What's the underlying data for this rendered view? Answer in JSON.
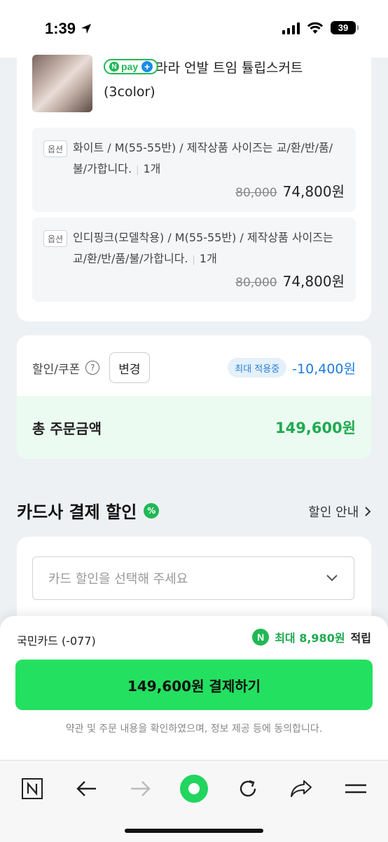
{
  "status_bar": {
    "time": "1:39",
    "battery": "39"
  },
  "product": {
    "npay_label": "pay",
    "npay_n": "N",
    "title": "라라 언발 트임 튤립스커트 (3color)",
    "options": [
      {
        "tag": "옵션",
        "description": "화이트 / M(55-55반) / 제작상품 사이즈는 교/환/반/품/불/가합니다.",
        "qty": "1개",
        "original_price": "80,000",
        "sale_price": "74,800원"
      },
      {
        "tag": "옵션",
        "description": "인디핑크(모델착용) / M(55-55반) / 제작상품 사이즈는 교/환/반/품/불/가합니다.",
        "qty": "1개",
        "original_price": "80,000",
        "sale_price": "74,800원"
      }
    ]
  },
  "summary": {
    "discount_label": "할인/쿠폰",
    "help": "?",
    "change_button": "변경",
    "max_badge": "최대 적용중",
    "discount_amount": "-10,400원",
    "total_label": "총 주문금액",
    "total_amount": "149,600원"
  },
  "card_discount": {
    "title": "카드사 결제 할인",
    "badge": "%",
    "guide_link": "할인 안내",
    "select_placeholder": "카드 할인을 선택해 주세요"
  },
  "checkout": {
    "card_name": "국민카드 (-077)",
    "reward_icon": "N",
    "reward_amount": "최대 8,980원",
    "reward_suffix": "적립",
    "pay_button": "149,600원 결제하기",
    "agreement": "약관 및 주문 내용을 확인하였으며, 정보 제공 등에 동의합니다."
  },
  "colors": {
    "accent_green": "#24e060",
    "price_green": "#1faa50",
    "discount_blue": "#1d7be0"
  }
}
